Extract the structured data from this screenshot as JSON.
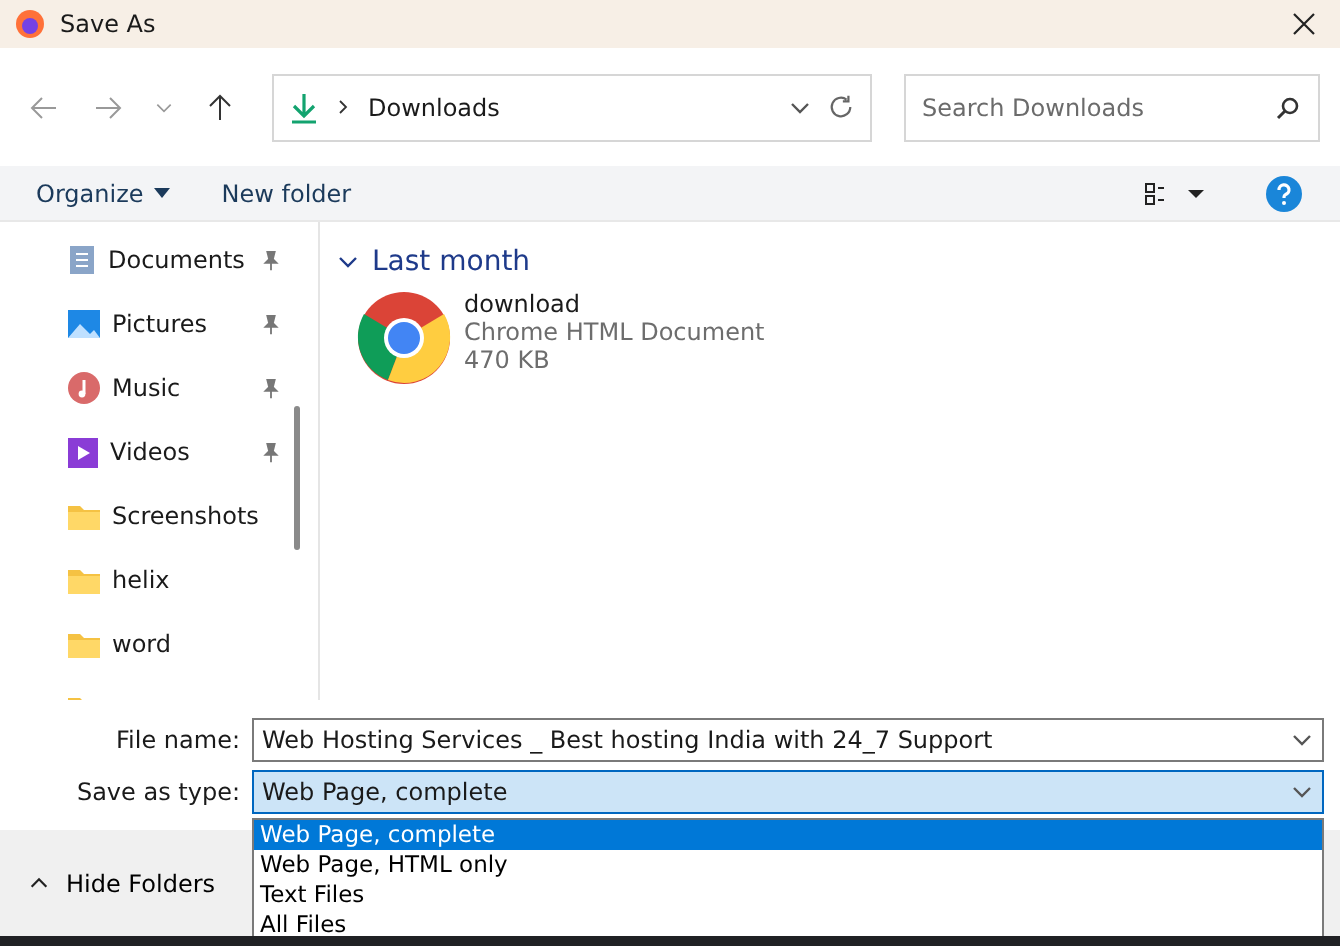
{
  "window": {
    "title": "Save As"
  },
  "address": {
    "location": "Downloads"
  },
  "search": {
    "placeholder": "Search Downloads"
  },
  "commands": {
    "organize": "Organize",
    "new_folder": "New folder"
  },
  "sidebar": {
    "items": [
      {
        "label": "Documents",
        "kind": "documents",
        "pinned": true
      },
      {
        "label": "Pictures",
        "kind": "pictures",
        "pinned": true
      },
      {
        "label": "Music",
        "kind": "music",
        "pinned": true
      },
      {
        "label": "Videos",
        "kind": "videos",
        "pinned": true
      },
      {
        "label": "Screenshots",
        "kind": "folder",
        "pinned": false
      },
      {
        "label": "helix",
        "kind": "folder",
        "pinned": false
      },
      {
        "label": "word",
        "kind": "folder",
        "pinned": false
      }
    ]
  },
  "groups": [
    {
      "title": "Last month",
      "expanded": true,
      "files": [
        {
          "name": "download",
          "type": "Chrome HTML Document",
          "size": "470 KB"
        }
      ]
    }
  ],
  "form": {
    "file_name_label": "File name:",
    "file_name": "Web Hosting Services _ Best hosting India with 24_7 Support",
    "type_label": "Save as type:",
    "type_value": "Web Page, complete",
    "type_options": [
      {
        "label": "Web Page, complete",
        "selected": true
      },
      {
        "label": "Web Page, HTML only",
        "selected": false
      },
      {
        "label": "Text Files",
        "selected": false
      },
      {
        "label": "All Files",
        "selected": false
      }
    ]
  },
  "footer": {
    "hide_folders": "Hide Folders"
  }
}
